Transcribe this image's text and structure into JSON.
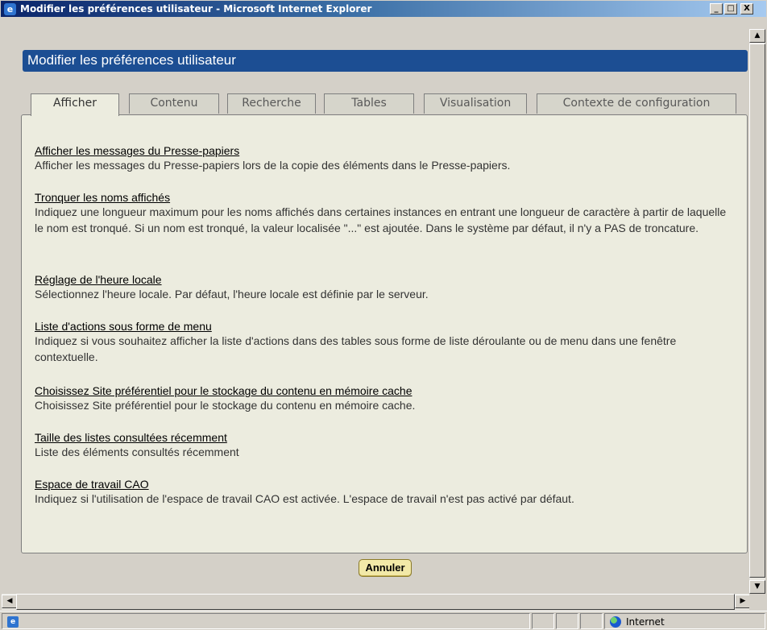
{
  "window": {
    "title": "Modifier les préférences utilisateur - Microsoft Internet Explorer",
    "controls": {
      "minimize": "_",
      "maximize": "□",
      "close": "X"
    }
  },
  "page": {
    "header": "Modifier les préférences utilisateur",
    "tabs": [
      {
        "label": "Afficher",
        "active": true
      },
      {
        "label": "Contenu",
        "active": false
      },
      {
        "label": "Recherche",
        "active": false
      },
      {
        "label": "Tables",
        "active": false
      },
      {
        "label": "Visualisation",
        "active": false
      },
      {
        "label": "Contexte de configuration",
        "active": false
      }
    ],
    "preferences": [
      {
        "title": "Afficher les messages du Presse-papiers",
        "description": "Afficher les messages du Presse-papiers lors de la copie des éléments dans le Presse-papiers."
      },
      {
        "title": "Tronquer les noms affichés",
        "description": "Indiquez une longueur maximum pour les noms affichés dans certaines instances en entrant une longueur de caractère à partir de laquelle le nom est tronqué. Si un nom est tronqué, la valeur localisée \"...\" est ajoutée. Dans le système par défaut, il n'y a PAS de troncature."
      },
      {
        "title": "Réglage de l'heure locale",
        "description": "Sélectionnez l'heure locale. Par défaut, l'heure locale est définie par le serveur."
      },
      {
        "title": "Liste d'actions sous forme de menu",
        "description": "Indiquez si vous souhaitez afficher la liste d'actions dans des tables sous forme de liste déroulante ou de menu dans une fenêtre contextuelle."
      },
      {
        "title": "Choisissez Site préférentiel pour le stockage du contenu en mémoire cache",
        "description": "Choisissez Site préférentiel pour le stockage du contenu en mémoire cache."
      },
      {
        "title": "Taille des listes consultées récemment",
        "description": "Liste des éléments consultés récemment"
      },
      {
        "title": "Espace de travail CAO",
        "description": "Indiquez si l'utilisation de l'espace de travail CAO est activée. L'espace de travail n'est pas activé par défaut."
      }
    ],
    "cancel_button": "Annuler"
  },
  "statusbar": {
    "zone": "Internet"
  },
  "colors": {
    "header_bg": "#1c4e93",
    "panel_bg": "#ececdf",
    "button_bg": "#f2e9a8"
  }
}
